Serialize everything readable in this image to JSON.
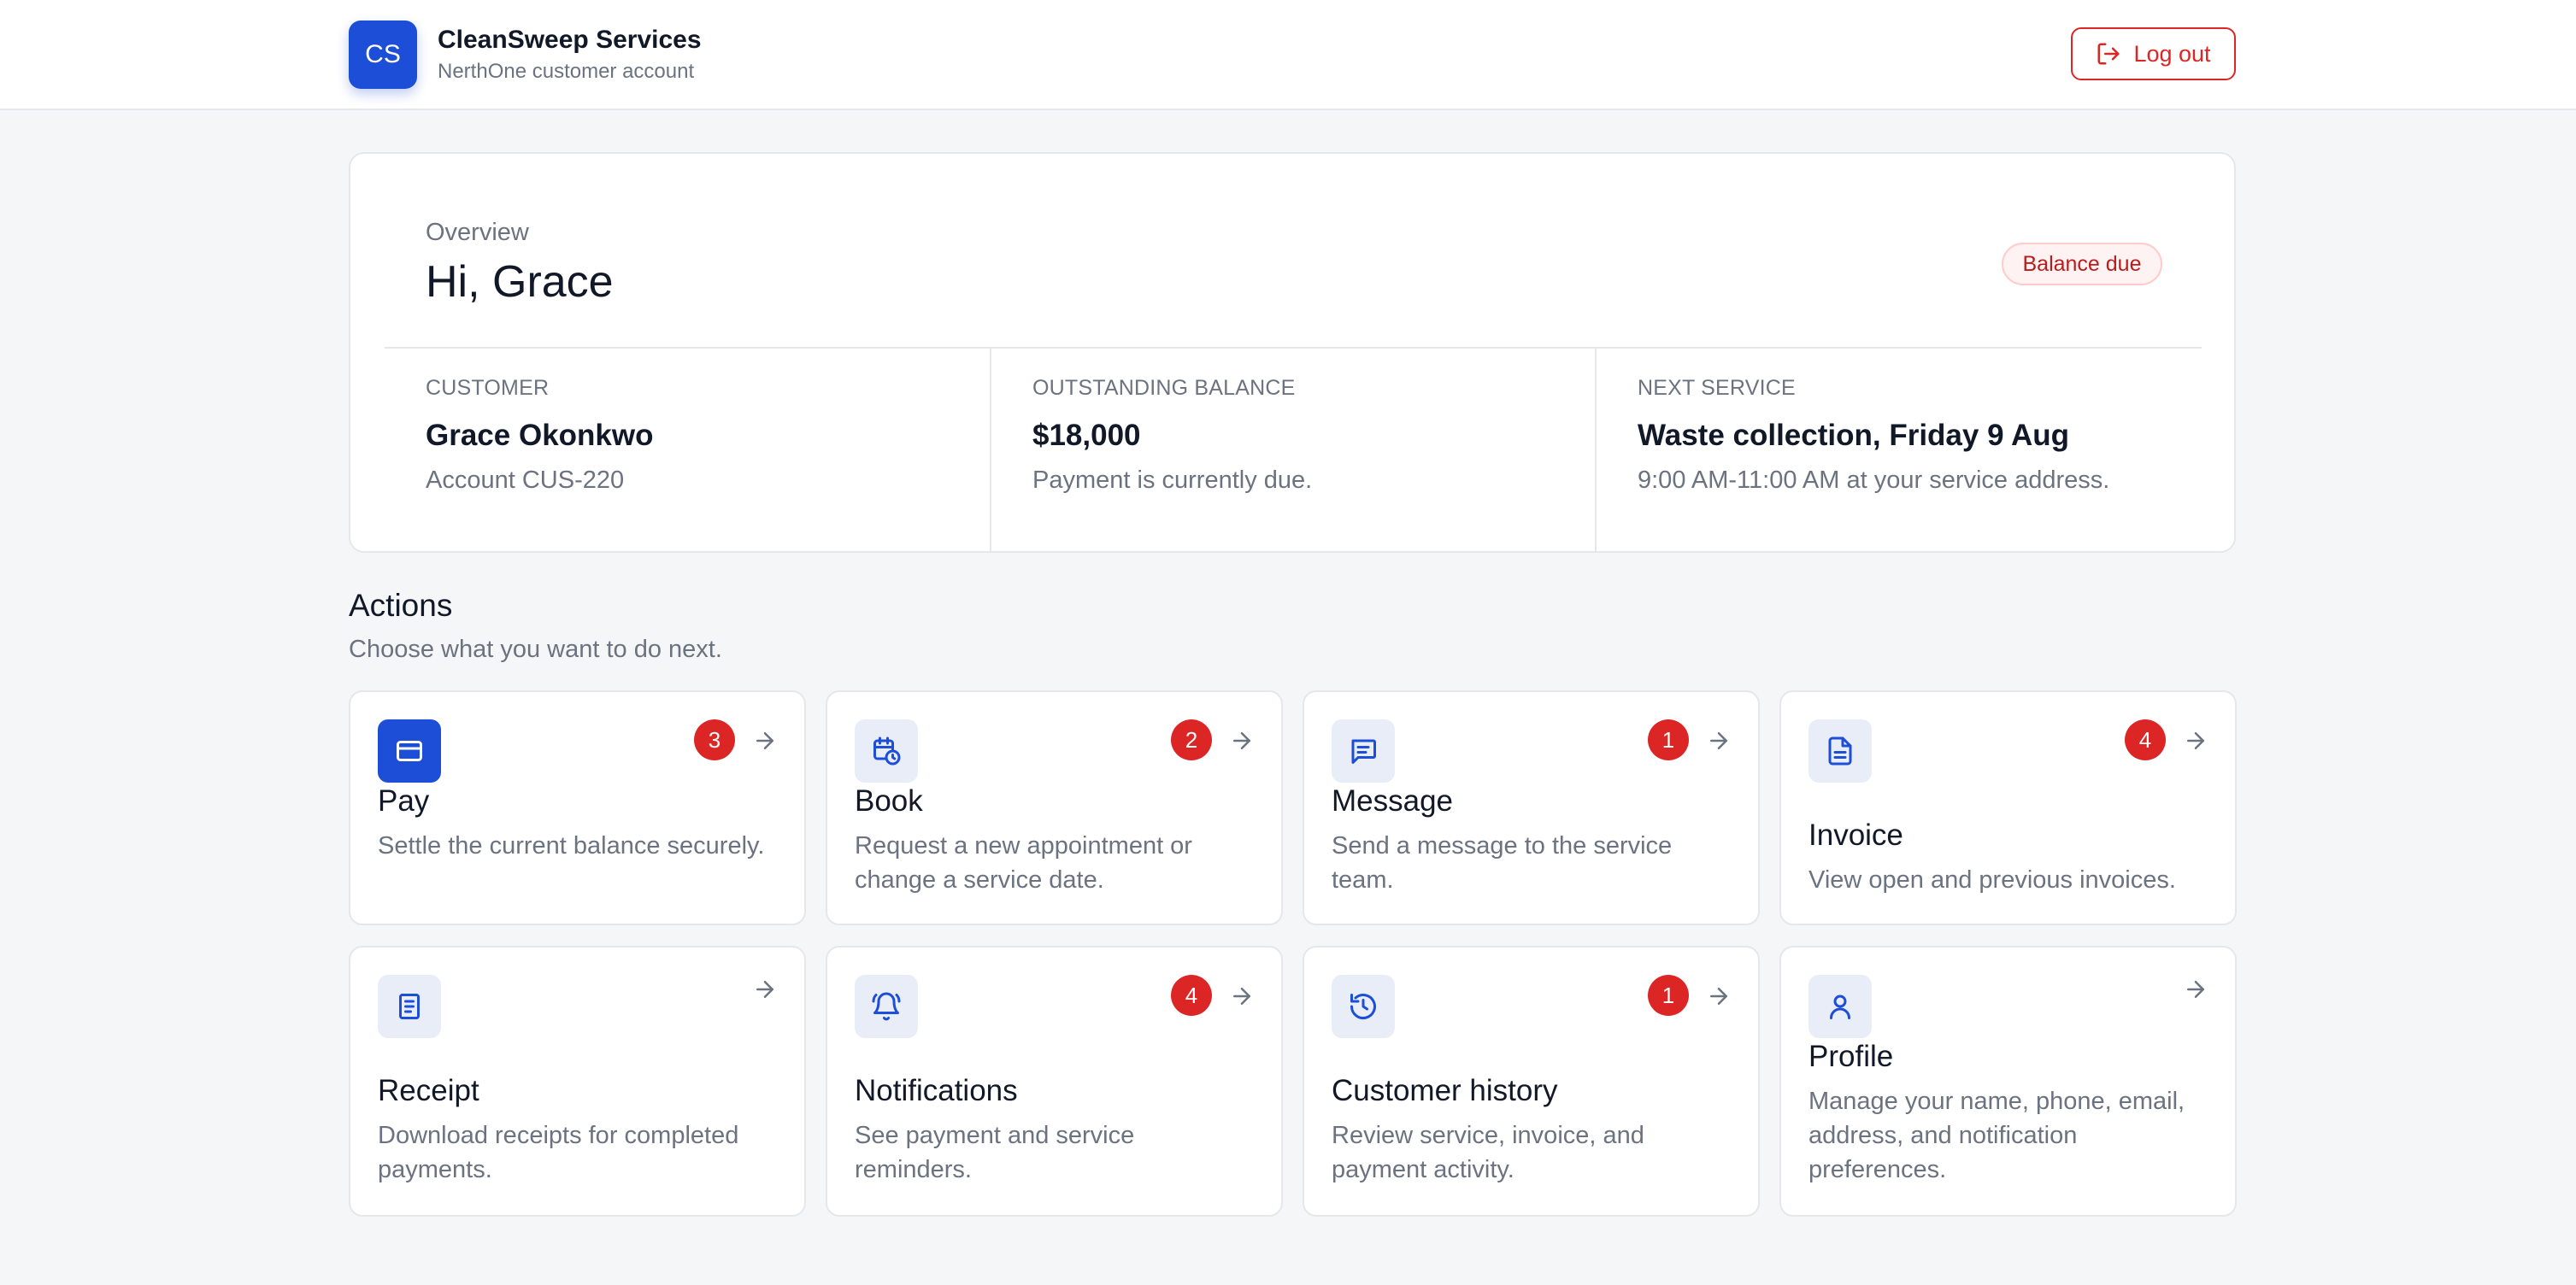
{
  "header": {
    "logo_initials": "CS",
    "company": "CleanSweep Services",
    "account_label": "NerthOne customer account",
    "logout_label": "Log out"
  },
  "overview": {
    "eyebrow": "Overview",
    "greeting": "Hi, Grace",
    "status_badge": "Balance due",
    "customer": {
      "label": "CUSTOMER",
      "value": "Grace Okonkwo",
      "sub": "Account CUS-220"
    },
    "balance": {
      "label": "OUTSTANDING BALANCE",
      "value": "$18,000",
      "sub": "Payment is currently due."
    },
    "next_service": {
      "label": "NEXT SERVICE",
      "value": "Waste collection, Friday 9 Aug",
      "sub": "9:00 AM-11:00 AM at your service address."
    }
  },
  "actions": {
    "title": "Actions",
    "subtitle": "Choose what you want to do next.",
    "cards": [
      {
        "icon": "credit-card-icon",
        "title": "Pay",
        "description": "Settle the current balance securely.",
        "badge": "3"
      },
      {
        "icon": "calendar-clock-icon",
        "title": "Book",
        "description": "Request a new appointment or change a service date.",
        "badge": "2"
      },
      {
        "icon": "message-icon",
        "title": "Message",
        "description": "Send a message to the service team.",
        "badge": "1"
      },
      {
        "icon": "document-icon",
        "title": "Invoice",
        "description": "View open and previous invoices.",
        "badge": "4"
      },
      {
        "icon": "receipt-icon",
        "title": "Receipt",
        "description": "Download receipts for completed payments.",
        "badge": ""
      },
      {
        "icon": "bell-icon",
        "title": "Notifications",
        "description": "See payment and service reminders.",
        "badge": "4"
      },
      {
        "icon": "history-icon",
        "title": "Customer history",
        "description": "Review service, invoice, and payment activity.",
        "badge": "1"
      },
      {
        "icon": "user-icon",
        "title": "Profile",
        "description": "Manage your name, phone, email, address, and notification preferences.",
        "badge": ""
      }
    ]
  },
  "colors": {
    "accent": "#1d4ed8",
    "danger": "#dc2626",
    "background": "#f5f6f8"
  }
}
